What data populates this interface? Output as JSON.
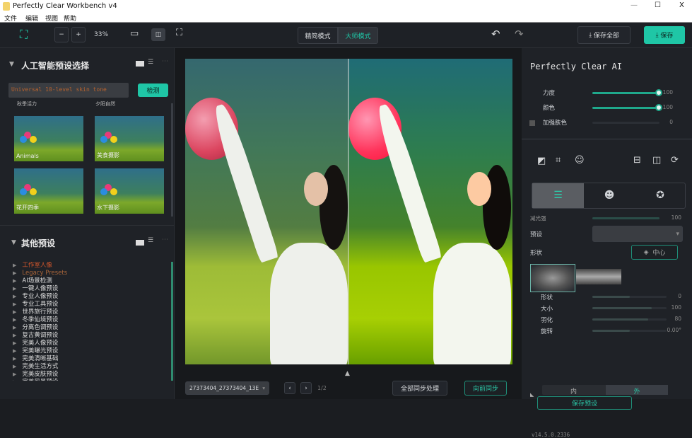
{
  "window": {
    "title": "Perfectly Clear Workbench v4",
    "controls": [
      "—",
      "☐",
      "X"
    ]
  },
  "menu": [
    "文件",
    "编辑",
    "视图",
    "帮助"
  ],
  "toolbar": {
    "zoom": "33%",
    "modes": [
      "精简模式",
      "大师模式"
    ],
    "active_mode": "大师模式",
    "save_all": "保存全部",
    "save": "保存"
  },
  "ai_presets": {
    "title": "人工智能预设选择",
    "input_value": "Universal 10-level skin tone",
    "detect_button": "检测",
    "cut_row": [
      "秋季活力",
      "夕阳自然"
    ],
    "thumbs": [
      "Animals",
      "美食摄影",
      "花开四季",
      "水下摄影"
    ]
  },
  "other_presets": {
    "title": "其他预设",
    "items": [
      "工作室人像",
      "Legacy Presets",
      "AI场景检测",
      "一键人像预设",
      "专业人像预设",
      "专业工具预设",
      "世界旅行预设",
      "冬季仙境预设",
      "分离色调预设",
      "复古黄调预设",
      "完美人像预设",
      "完美曝光预设",
      "完美清晰基础",
      "完美生活方式",
      "完美皮肤预设",
      "完美风景预设"
    ],
    "highlight_colors": [
      "#d2562c",
      "#a8653a"
    ]
  },
  "bottom": {
    "file": "27373404_27373404_13E",
    "page": "1/2",
    "sync_all": "全部同步处理",
    "sync_to": "向前同步"
  },
  "right": {
    "title": "Perfectly Clear AI",
    "sliders": [
      {
        "label": "力度",
        "value": 100
      },
      {
        "label": "颜色",
        "value": 100
      },
      {
        "label": "加强肤色",
        "value": 0
      }
    ],
    "vignette": {
      "strength_label": "减光强",
      "strength": 100,
      "preset_label": "预设",
      "shape_label": "形状",
      "center_button": "中心",
      "params": [
        {
          "label": "形状",
          "value": "0",
          "fill": 0.5
        },
        {
          "label": "大小",
          "value": "100",
          "fill": 0.8
        },
        {
          "label": "羽化",
          "value": "80",
          "fill": 0.75
        },
        {
          "label": "旋转",
          "value": "0.00°",
          "fill": 0.5
        }
      ],
      "toggle": [
        "内",
        "外"
      ],
      "save_preset": "保存预设"
    },
    "version": "v14.5.0.2336"
  },
  "colors": {
    "accent": "#1fc6a6",
    "bg": "#1f2227"
  }
}
